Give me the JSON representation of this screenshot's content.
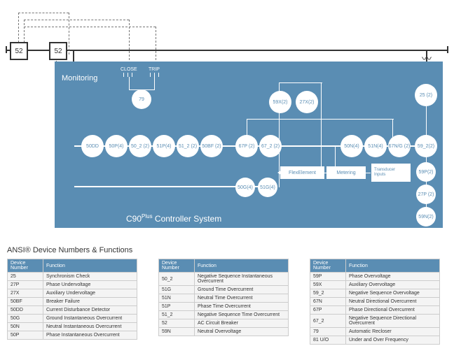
{
  "title": "ANSI® Device Numbers & Functions",
  "system_label": "C90",
  "system_sup": "Plus",
  "system_suffix": " Controller System",
  "monitoring": "Monitoring",
  "close_label": "CLOSE",
  "trip_label": "TRIP",
  "breakers": [
    "52",
    "52"
  ],
  "row1_nodes": [
    "50DD",
    "50P(4)",
    "50_2 (2)",
    "51P(4)",
    "51_2 (2)",
    "50BF (2)"
  ],
  "row1_right": [
    "67P (2)",
    "67_2 (2)"
  ],
  "row1_far": [
    "50N(4)",
    "51N(4)",
    "67N/G (2)",
    "59_2(2)"
  ],
  "top_pair": [
    "59X(2)",
    "27X(2)"
  ],
  "right_top": "25 (2)",
  "vert_right": [
    "59P(2)",
    "27P (2)",
    "59N(2)"
  ],
  "mid_row": [
    "50G(4)",
    "51G(4)"
  ],
  "flex": "FlexElement",
  "metering": "Metering",
  "transducer": "Transducer Inputs",
  "node79": "79",
  "tbl1_head": [
    "Device Number",
    "Function"
  ],
  "tbl1": [
    [
      "25",
      "Synchronism Check"
    ],
    [
      "27P",
      "Phase Undervoltage"
    ],
    [
      "27X",
      "Auxiliary Undervoltage"
    ],
    [
      "50BF",
      "Breaker Failure"
    ],
    [
      "50DD",
      "Current Disturbance Detector"
    ],
    [
      "50G",
      "Ground Instantaneous Overcurrent"
    ],
    [
      "50N",
      "Neutral Instantaneous Overcurrent"
    ],
    [
      "50P",
      "Phase Instantaneous Overcurrent"
    ]
  ],
  "tbl2": [
    [
      "50_2",
      "Negative Sequence Instantaneous Overcurrent"
    ],
    [
      "51G",
      "Ground Time Overcurrent"
    ],
    [
      "51N",
      "Neutral Time Overcurrent"
    ],
    [
      "51P",
      "Phase Time Overcurrent"
    ],
    [
      "51_2",
      "Negative Sequence Time Overcurrent"
    ],
    [
      "52",
      "AC Circuit Breaker"
    ],
    [
      "59N",
      "Neutral Overvoltage"
    ]
  ],
  "tbl3": [
    [
      "59P",
      "Phase Overvoltage"
    ],
    [
      "59X",
      "Auxiliary Overvoltage"
    ],
    [
      "59_2",
      "Negative Sequence Overvoltage"
    ],
    [
      "67N",
      "Neutral Directional Overcurrent"
    ],
    [
      "67P",
      "Phase Directional Overcurrent"
    ],
    [
      "67_2",
      "Negative Sequence Directional Overcurrent"
    ],
    [
      "79",
      "Automatic Recloser"
    ],
    [
      "81 U/O",
      "Under and Over Frequency"
    ]
  ]
}
